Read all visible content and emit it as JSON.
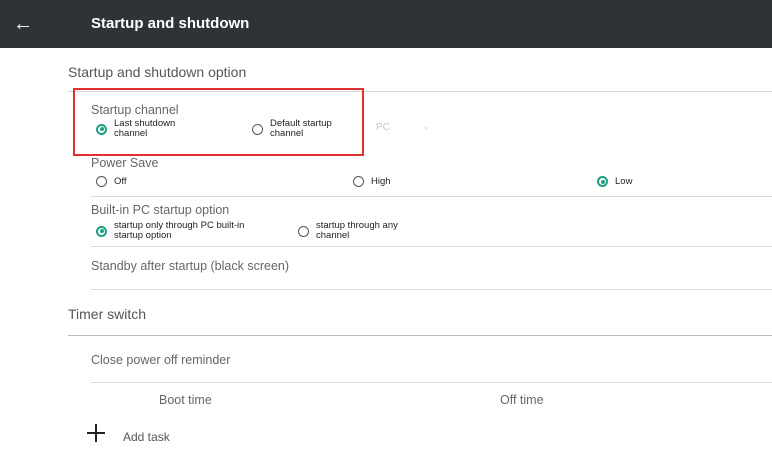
{
  "appbar": {
    "title": "Startup and shutdown",
    "back_icon": "arrow-left-icon"
  },
  "section_startup": {
    "title": "Startup and shutdown option"
  },
  "startup_channel": {
    "title": "Startup channel",
    "options": [
      {
        "label": "Last shutdown\nchannel",
        "checked": true
      },
      {
        "label": "Default startup\nchannel",
        "checked": false
      }
    ],
    "source": "PC"
  },
  "power_save": {
    "title": "Power Save",
    "options": [
      {
        "label": "Off",
        "checked": false
      },
      {
        "label": "High",
        "checked": false
      },
      {
        "label": "Low",
        "checked": true
      }
    ]
  },
  "pc_startup": {
    "title": "Built-in PC startup option",
    "options": [
      {
        "label": "startup only through PC built-in\nstartup option",
        "checked": true
      },
      {
        "label": "startup through any\nchannel",
        "checked": false
      }
    ]
  },
  "standby": {
    "label": "Standby after startup (black screen)"
  },
  "section_timer": {
    "title": "Timer switch"
  },
  "reminder": {
    "label": "Close power off reminder"
  },
  "timer_table": {
    "columns": [
      "Boot time",
      "Off time"
    ]
  },
  "add_task": {
    "label": "Add task"
  },
  "colors": {
    "appbar": "#2f3336",
    "accent": "#1e9e80",
    "highlight": "#e03030"
  }
}
